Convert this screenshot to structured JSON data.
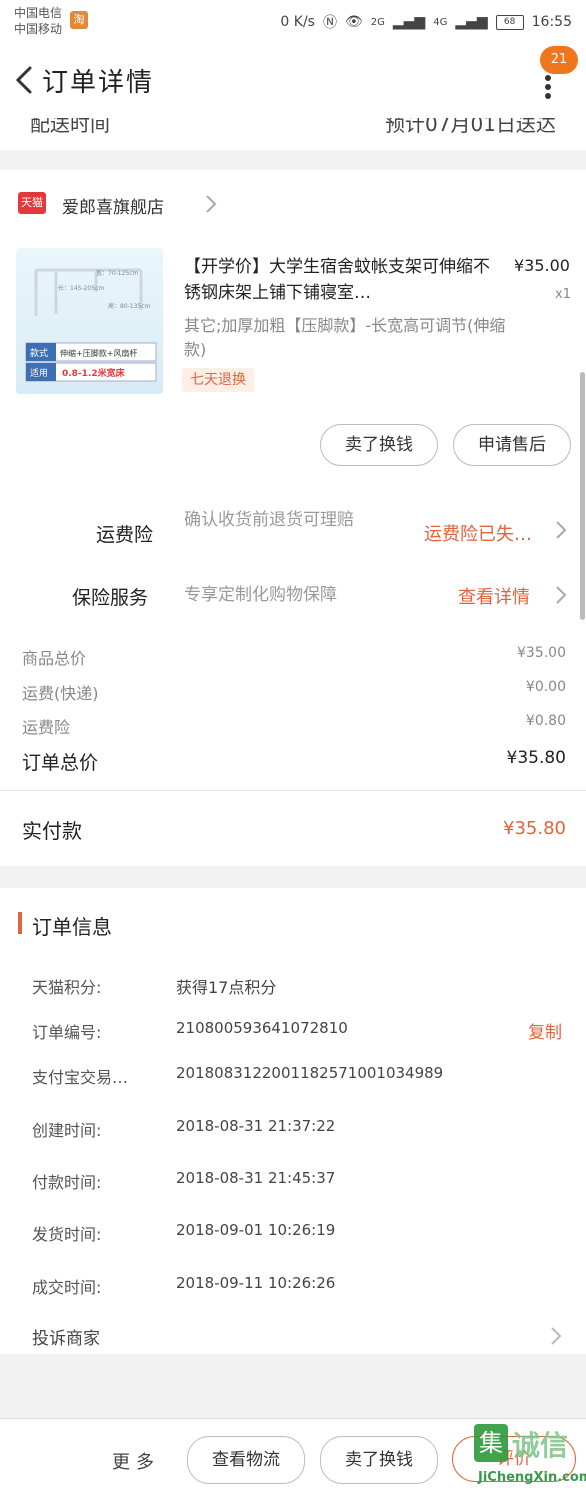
{
  "status_bar": {
    "carrier1": "中国电信",
    "carrier2": "中国移动",
    "taobao_icon_glyph": "淘",
    "net_speed": "0 K/s",
    "signal1": "2G",
    "signal2": "4G",
    "battery": "68",
    "time": "16:55"
  },
  "header": {
    "title": "订单详情",
    "badge": "21"
  },
  "partial_row": {
    "left": "配送时间",
    "right": "预计07月01日送达"
  },
  "store": {
    "icon_label": "天猫",
    "name": "爱郎喜旗舰店"
  },
  "product": {
    "title": "【开学价】大学生宿舍蚊帐支架可伸缩不锈钢床架上铺下铺寝室…",
    "price": "¥35.00",
    "qty": "x1",
    "sku": "其它;加厚加粗【压脚款】-长宽高可调节(伸缩款)",
    "return_tag": "七天退换",
    "img_text1": "款式",
    "img_text2": "伸缩+压脚款+风扇杆",
    "img_text3": "适用",
    "img_text4": "0.8-1.2米宽床",
    "img_dim1": "长：145-205cm",
    "img_dim2": "宽：70-125cm",
    "img_dim3": "高：80-135cm"
  },
  "actions": {
    "sold_exchange": "卖了换钱",
    "apply_after_sale": "申请售后"
  },
  "shipping_insurance": {
    "label": "运费险",
    "desc": "确认收货前退货可理赔",
    "status": "运费险已失…"
  },
  "insurance_service": {
    "label": "保险服务",
    "desc": "专享定制化购物保障",
    "link": "查看详情"
  },
  "fees": {
    "goods_label": "商品总价",
    "goods_val": "¥35.00",
    "ship_label": "运费(快递)",
    "ship_val": "¥0.00",
    "ins_label": "运费险",
    "ins_val": "¥0.80",
    "total_label": "订单总价",
    "total_val": "¥35.80",
    "paid_label": "实付款",
    "paid_val": "¥35.80"
  },
  "order_info": {
    "title": "订单信息",
    "rows": [
      {
        "label": "天猫积分:",
        "value": "获得17点积分"
      },
      {
        "label": "订单编号:",
        "value": "210800593641072810"
      },
      {
        "label": "支付宝交易…",
        "value": "2018083122001182571001034989"
      },
      {
        "label": "创建时间:",
        "value": "2018-08-31 21:37:22"
      },
      {
        "label": "付款时间:",
        "value": "2018-08-31 21:45:37"
      },
      {
        "label": "发货时间:",
        "value": "2018-09-01 10:26:19"
      },
      {
        "label": "成交时间:",
        "value": "2018-09-11 10:26:26"
      }
    ],
    "copy": "复制",
    "complaint": "投诉商家"
  },
  "bottom": {
    "more": "更多",
    "logistics": "查看物流",
    "sold_exchange": "卖了换钱",
    "confirm": "评价"
  },
  "watermark": {
    "mark": "集",
    "text": "诚信",
    "url": "JiChengXin.com"
  },
  "colors": {
    "accent": "#e2643c",
    "badge": "#f0761e"
  }
}
